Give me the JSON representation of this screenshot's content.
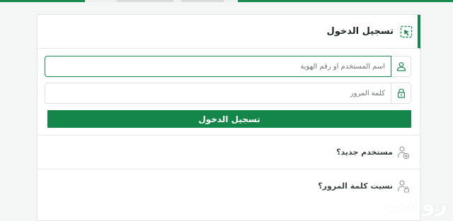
{
  "login": {
    "title": "تسجيل الدخول",
    "username_placeholder": "اسم المستخدم أو رقم الهوية",
    "password_placeholder": "كلمة المرور",
    "submit_label": "تسجيل الدخول"
  },
  "links": {
    "new_user": "مستخدم جديد؟",
    "forgot_password": "نسيت كلمة المرور؟"
  },
  "watermark": "رواتب",
  "colors": {
    "accent": "#15864a",
    "icon": "#1a8a4d",
    "link_icon": "#9aa39e"
  },
  "icons": {
    "header": "login-arrow-icon",
    "username": "user-icon",
    "password": "lock-icon",
    "new_user": "user-plus-icon",
    "forgot_password": "user-lock-icon"
  }
}
